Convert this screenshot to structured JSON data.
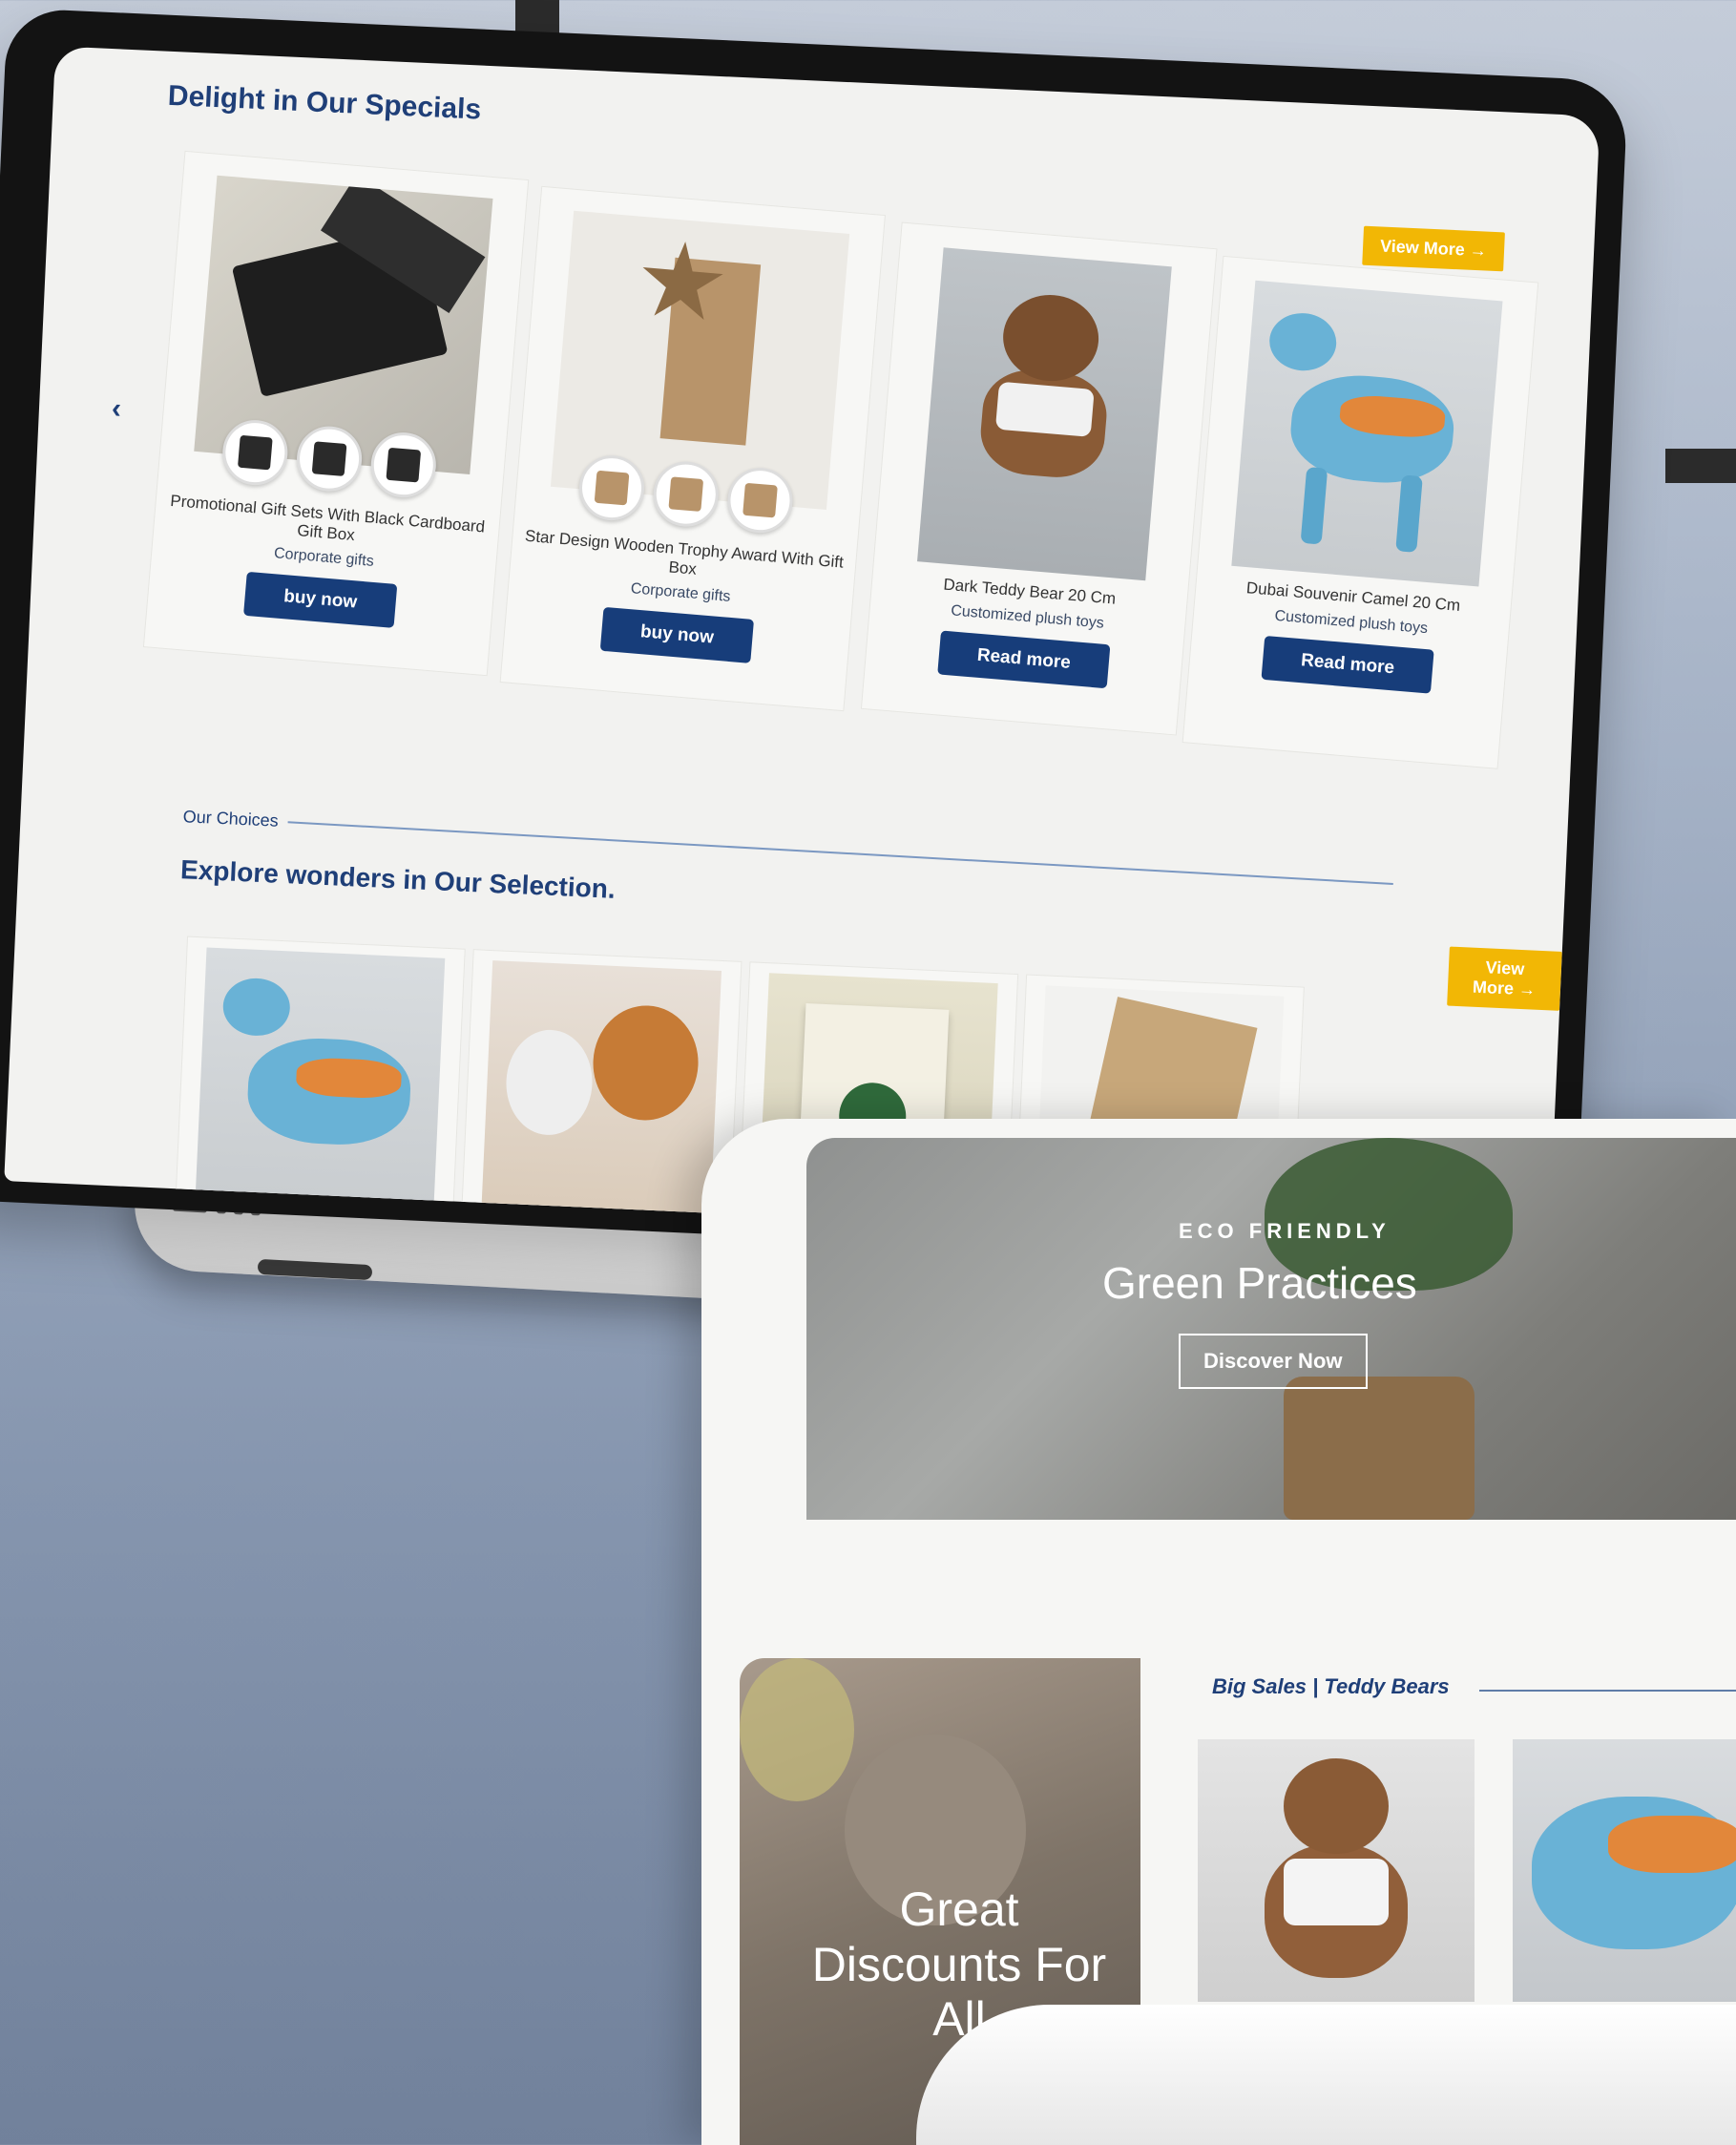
{
  "specials": {
    "title": "Delight in Our Specials",
    "view_more": "View More →",
    "products": [
      {
        "name": "Promotional Gift Sets With Black Cardboard Gift Box",
        "category": "Corporate gifts",
        "button": "buy now"
      },
      {
        "name": "Star Design Wooden Trophy Award With Gift Box",
        "category": "Corporate gifts",
        "button": "buy now"
      },
      {
        "name": "Dark Teddy Bear 20 Cm",
        "category": "Customized plush toys",
        "button": "Read more"
      },
      {
        "name": "Dubai Souvenir Camel 20 Cm",
        "category": "Customized plush toys",
        "button": "Read more"
      }
    ]
  },
  "choices": {
    "label": "Our Choices",
    "title": "Explore wonders in Our Selection.",
    "view_more": "View More →"
  },
  "hero": {
    "eyebrow": "ECO FRIENDLY",
    "headline": "Green Practices",
    "button": "Discover Now"
  },
  "discount": {
    "text": "Great Discounts For All"
  },
  "sales": {
    "label": "Big Sales | Teddy Bears"
  },
  "colors": {
    "brand_navy": "#173d7a",
    "accent_yellow": "#f2b705",
    "title_blue": "#1f3f78"
  },
  "icons": {
    "prev": "chevron-left-icon"
  }
}
